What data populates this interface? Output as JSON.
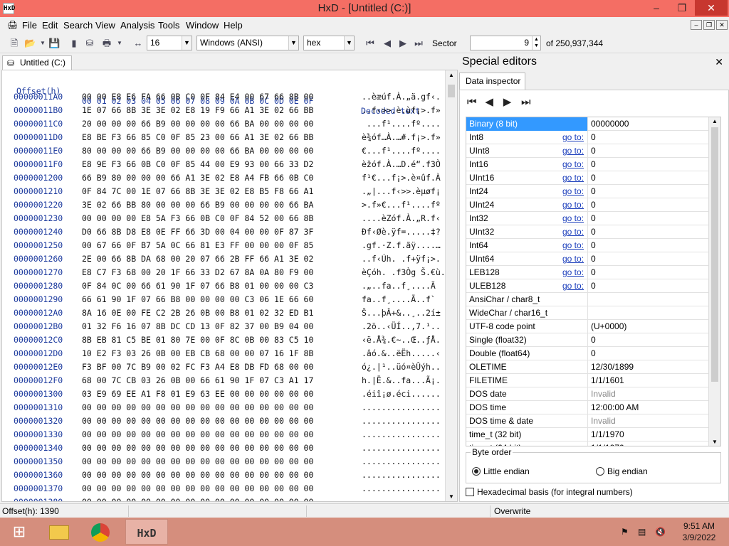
{
  "window": {
    "title": "HxD - [Untitled (C:)]",
    "app_icon": "HxD"
  },
  "menu": [
    "File",
    "Edit",
    "Search",
    "View",
    "Analysis",
    "Tools",
    "Window",
    "Help"
  ],
  "toolbar": {
    "bytes_per_row": "16",
    "charset": "Windows (ANSI)",
    "offset_base": "hex",
    "sector_label": "Sector",
    "sector_value": "9",
    "sector_total": "of 250,937,344"
  },
  "tab": {
    "label": "Untitled (C:)"
  },
  "hex": {
    "header_offset": "Offset(h)",
    "header_columns": "00 01 02 03 04 05 06 07 08 09 0A 0B 0C 0D 0E 0F",
    "header_decoded": "Decoded text",
    "rows": [
      {
        "o": "00000011A0",
        "b": "00 00 E8 E6 FA 66 0B C0 0F 84 E4 00 67 66 8B 00",
        "t": "..èæúf.À.„ä.gf‹."
      },
      {
        "o": "00000011B0",
        "b": "1E 07 66 8B 3E 3E 02 E8 19 F9 66 A1 3E 02 66 BB",
        "t": "..f‹>>.è.ùf¡>.f»"
      },
      {
        "o": "00000011C0",
        "b": "20 00 00 00 66 B9 00 00 00 00 66 BA 00 00 00 00",
        "t": " ...f¹....fº...."
      },
      {
        "o": "00000011D0",
        "b": "E8 BE F3 66 85 C0 0F 85 23 00 66 A1 3E 02 66 BB",
        "t": "è¾óf…À.…#.f¡>.f»"
      },
      {
        "o": "00000011E0",
        "b": "80 00 00 00 66 B9 00 00 00 00 66 BA 00 00 00 00",
        "t": "€...f¹....fº...."
      },
      {
        "o": "00000011F0",
        "b": "E8 9E F3 66 0B C0 0F 85 44 00 E9 93 00 66 33 D2",
        "t": "èžóf.À.…D.é“.f3Ò"
      },
      {
        "o": "0000001200",
        "b": "66 B9 80 00 00 00 66 A1 3E 02 E8 A4 FB 66 0B C0",
        "t": "f¹€...f¡>.è¤ûf.À"
      },
      {
        "o": "0000001210",
        "b": "0F 84 7C 00 1E 07 66 8B 3E 3E 02 E8 B5 F8 66 A1",
        "t": ".„|...f‹>>.èµøf¡"
      },
      {
        "o": "0000001220",
        "b": "3E 02 66 BB 80 00 00 00 66 B9 00 00 00 00 66 BA",
        "t": ">.f»€...f¹....fº"
      },
      {
        "o": "0000001230",
        "b": "00 00 00 00 E8 5A F3 66 0B C0 0F 84 52 00 66 8B",
        "t": "....èZóf.À.„R.f‹"
      },
      {
        "o": "0000001240",
        "b": "D0 66 8B D8 E8 0E FF 66 3D 00 04 00 00 0F 87 3F",
        "t": "Ðf‹Øè.ÿf=.....‡?"
      },
      {
        "o": "0000001250",
        "b": "00 67 66 0F B7 5A 0C 66 81 E3 FF 00 00 00 0F 85",
        "t": ".gf.·Z.f.ãÿ....…"
      },
      {
        "o": "0000001260",
        "b": "2E 00 66 8B DA 68 00 20 07 66 2B FF 66 A1 3E 02",
        "t": "..f‹Úh. .f+ÿf¡>."
      },
      {
        "o": "0000001270",
        "b": "E8 C7 F3 68 00 20 1F 66 33 D2 67 8A 0A 80 F9 00",
        "t": "èÇóh. .f3Òg Š.€ù."
      },
      {
        "o": "0000001280",
        "b": "0F 84 0C 00 66 61 90 1F 07 66 B8 01 00 00 00 C3",
        "t": ".„..fa..f¸....Ã"
      },
      {
        "o": "0000001290",
        "b": "66 61 90 1F 07 66 B8 00 00 00 00 C3 06 1E 66 60",
        "t": "fa..f¸....Ã..f`"
      },
      {
        "o": "00000012A0",
        "b": "8A 16 0E 00 FE C2 2B 26 0B 00 B8 01 02 32 ED B1",
        "t": "Š...þÂ+&..¸..2í±"
      },
      {
        "o": "00000012B0",
        "b": "01 32 F6 16 07 8B DC CD 13 0F 82 37 00 B9 04 00",
        "t": ".2ö..‹ÜÍ..‚7.¹.."
      },
      {
        "o": "00000012C0",
        "b": "8B EB 81 C5 BE 01 80 7E 00 0F 8C 0B 00 83 C5 10",
        "t": "‹ë.Å¾.€~..Œ..ƒÅ."
      },
      {
        "o": "00000012D0",
        "b": "10 E2 F3 03 26 0B 00 EB CB 68 00 00 07 16 1F 8B",
        "t": ".âó.&..ëËh.....‹"
      },
      {
        "o": "00000012E0",
        "b": "F3 BF 00 7C B9 00 02 FC F3 A4 E8 DB FD 68 00 00",
        "t": "ó¿.|¹..üó¤èÛýh.."
      },
      {
        "o": "00000012F0",
        "b": "68 00 7C CB 03 26 0B 00 66 61 90 1F 07 C3 A1 17",
        "t": "h.|Ë.&..fa...Ã¡."
      },
      {
        "o": "0000001300",
        "b": "03 E9 69 EE A1 F8 01 E9 63 EE 00 00 00 00 00 00",
        "t": ".éiî¡ø.éci......"
      },
      {
        "o": "0000001310",
        "b": "00 00 00 00 00 00 00 00 00 00 00 00 00 00 00 00",
        "t": "................"
      },
      {
        "o": "0000001320",
        "b": "00 00 00 00 00 00 00 00 00 00 00 00 00 00 00 00",
        "t": "................"
      },
      {
        "o": "0000001330",
        "b": "00 00 00 00 00 00 00 00 00 00 00 00 00 00 00 00",
        "t": "................"
      },
      {
        "o": "0000001340",
        "b": "00 00 00 00 00 00 00 00 00 00 00 00 00 00 00 00",
        "t": "................"
      },
      {
        "o": "0000001350",
        "b": "00 00 00 00 00 00 00 00 00 00 00 00 00 00 00 00",
        "t": "................"
      },
      {
        "o": "0000001360",
        "b": "00 00 00 00 00 00 00 00 00 00 00 00 00 00 00 00",
        "t": "................"
      },
      {
        "o": "0000001370",
        "b": "00 00 00 00 00 00 00 00 00 00 00 00 00 00 00 00",
        "t": "................"
      },
      {
        "o": "0000001380",
        "b": "00 00 00 00 00 00 00 00 00 00 00 00 00 00 00 00",
        "t": "................"
      },
      {
        "o": "0000001390",
        "b": "00 00 00 00 00 00 00 00 00 00 00 00 00 00 00 00",
        "t": "................"
      },
      {
        "o": "00000013A0",
        "b": "00 00 00 00 00 00 00 00 00 00 00 00 00 00 00 00",
        "t": "................"
      },
      {
        "o": "00000013B0",
        "b": "00 00 00 00 00 00 00 00 00 00 00 00 00 00 00 00",
        "t": "................"
      },
      {
        "o": "00000013C0",
        "b": "00 00 00 00 00 00 00 00 00 00 00 00 00 00 00 00",
        "t": "................"
      }
    ]
  },
  "special_editors": {
    "title": "Special editors",
    "tab": "Data inspector",
    "rows": [
      {
        "name": "Binary (8 bit)",
        "goto": "",
        "value": "00000000",
        "selected": true
      },
      {
        "name": "Int8",
        "goto": "go to:",
        "value": "0"
      },
      {
        "name": "UInt8",
        "goto": "go to:",
        "value": "0"
      },
      {
        "name": "Int16",
        "goto": "go to:",
        "value": "0"
      },
      {
        "name": "UInt16",
        "goto": "go to:",
        "value": "0"
      },
      {
        "name": "Int24",
        "goto": "go to:",
        "value": "0"
      },
      {
        "name": "UInt24",
        "goto": "go to:",
        "value": "0"
      },
      {
        "name": "Int32",
        "goto": "go to:",
        "value": "0"
      },
      {
        "name": "UInt32",
        "goto": "go to:",
        "value": "0"
      },
      {
        "name": "Int64",
        "goto": "go to:",
        "value": "0"
      },
      {
        "name": "UInt64",
        "goto": "go to:",
        "value": "0"
      },
      {
        "name": "LEB128",
        "goto": "go to:",
        "value": "0"
      },
      {
        "name": "ULEB128",
        "goto": "go to:",
        "value": "0"
      },
      {
        "name": "AnsiChar / char8_t",
        "goto": "",
        "value": ""
      },
      {
        "name": "WideChar / char16_t",
        "goto": "",
        "value": ""
      },
      {
        "name": "UTF-8 code point",
        "goto": "",
        "value": "  (U+0000)"
      },
      {
        "name": "Single (float32)",
        "goto": "",
        "value": "0"
      },
      {
        "name": "Double (float64)",
        "goto": "",
        "value": "0"
      },
      {
        "name": "OLETIME",
        "goto": "",
        "value": "12/30/1899"
      },
      {
        "name": "FILETIME",
        "goto": "",
        "value": "1/1/1601"
      },
      {
        "name": "DOS date",
        "goto": "",
        "value": "Invalid",
        "muted": true
      },
      {
        "name": "DOS time",
        "goto": "",
        "value": "12:00:00 AM"
      },
      {
        "name": "DOS time & date",
        "goto": "",
        "value": "Invalid",
        "muted": true
      },
      {
        "name": "time_t (32 bit)",
        "goto": "",
        "value": "1/1/1970"
      },
      {
        "name": "time_t (64 bit)",
        "goto": "",
        "value": "1/1/1970"
      }
    ],
    "byte_order_label": "Byte order",
    "little_endian": "Little endian",
    "big_endian": "Big endian",
    "hex_basis": "Hexadecimal basis (for integral numbers)"
  },
  "status": {
    "offset": "Offset(h): 1390",
    "mode": "Overwrite"
  },
  "taskbar": {
    "time": "9:51 AM",
    "date": "3/9/2022",
    "hxd_label": "HxD"
  }
}
